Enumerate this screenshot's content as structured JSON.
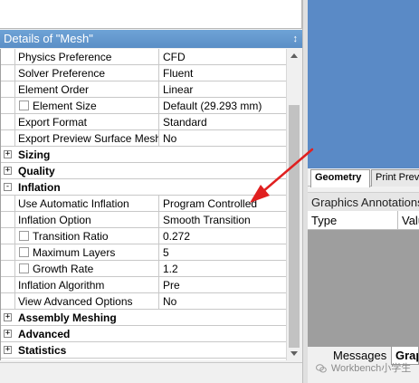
{
  "details": {
    "title": "Details of \"Mesh\"",
    "pin_glyph": "↕",
    "rows": [
      {
        "label": "Physics Preference",
        "value": "CFD"
      },
      {
        "label": "Solver Preference",
        "value": "Fluent"
      },
      {
        "label": "Element Order",
        "value": "Linear"
      },
      {
        "label": "Element Size",
        "value": "Default (29.293 mm)"
      },
      {
        "label": "Export Format",
        "value": "Standard"
      },
      {
        "label": "Export Preview Surface Mesh",
        "value": "No"
      },
      {
        "label": "Sizing"
      },
      {
        "label": "Quality"
      },
      {
        "label": "Inflation"
      },
      {
        "label": "Use Automatic Inflation",
        "value": "Program Controlled"
      },
      {
        "label": "Inflation Option",
        "value": "Smooth Transition"
      },
      {
        "label": "Transition Ratio",
        "value": "0.272"
      },
      {
        "label": "Maximum Layers",
        "value": "5"
      },
      {
        "label": "Growth Rate",
        "value": "1.2"
      },
      {
        "label": "Inflation Algorithm",
        "value": "Pre"
      },
      {
        "label": "View Advanced Options",
        "value": "No"
      },
      {
        "label": "Assembly Meshing"
      },
      {
        "label": "Advanced"
      },
      {
        "label": "Statistics"
      }
    ],
    "expand_plus": "+",
    "expand_minus": "-"
  },
  "right": {
    "tabs": [
      "Geometry",
      "Print Preview"
    ],
    "annotations_title": "Graphics Annotations",
    "columns": [
      "Type",
      "Value"
    ],
    "bottom_tabs": [
      "Messages",
      "Graphics"
    ]
  },
  "watermark": "Workbench小学生",
  "colors": {
    "header_blue": "#5b8fc6",
    "annotation_arrow": "#e02020"
  }
}
